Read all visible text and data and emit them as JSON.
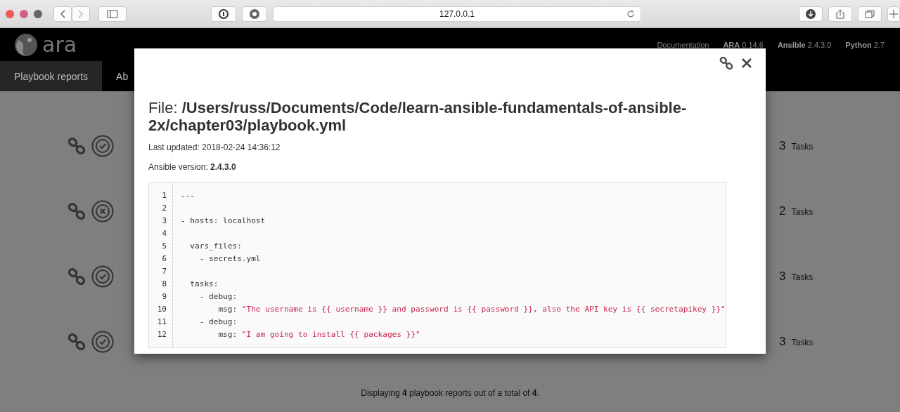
{
  "browser": {
    "url": "127.0.0.1"
  },
  "navbar": {
    "logo": "ara",
    "links": [
      {
        "label": "Documentation"
      },
      {
        "label": "ARA",
        "value": "0.14.6"
      },
      {
        "label": "Ansible",
        "value": "2.4.3.0"
      },
      {
        "label": "Python",
        "value": "2.7"
      }
    ],
    "tabs": [
      {
        "label": "Playbook reports",
        "selected": true
      },
      {
        "label": "Ab",
        "selected": false
      }
    ]
  },
  "reports": [
    {
      "failed": false,
      "tasks": "3",
      "tasks_label": "Tasks"
    },
    {
      "failed": true,
      "tasks": "2",
      "tasks_label": "Tasks"
    },
    {
      "failed": false,
      "tasks": "3",
      "tasks_label": "Tasks"
    },
    {
      "failed": false,
      "tasks": "3",
      "tasks_label": "Tasks"
    }
  ],
  "footer": "Displaying **4** playbook reports out of a total of **4**.",
  "modal": {
    "title": "File: **/Users/russ/Documents/Code/learn-ansible-fundamentals-of-ansible-2x/chapter03/playbook.yml**",
    "last_updated": "Last updated: 2018-02-24 14:36:12",
    "ansible_version": "Ansible version: **2.4.3.0**",
    "code": [
      {
        "number": "1",
        "code": "---"
      },
      {
        "number": "2"
      },
      {
        "number": "3",
        "code": "- hosts: localhost"
      },
      {
        "number": "4"
      },
      {
        "number": "5",
        "code": "  vars_files:"
      },
      {
        "number": "6",
        "code": "    - secrets.yml"
      },
      {
        "number": "7"
      },
      {
        "number": "8",
        "code": "  tasks:"
      },
      {
        "number": "9",
        "code": "    - debug:"
      },
      {
        "number": "10",
        "code": "        msg: ",
        "string": "\"The username is {{ username }} and password is {{ password }}, also the API key is {{ secretapikey }}\""
      },
      {
        "number": "11",
        "code": "    - debug:"
      },
      {
        "number": "12",
        "code": "        msg: ",
        "string": "\"I am going to install {{ packages }}\""
      }
    ]
  }
}
